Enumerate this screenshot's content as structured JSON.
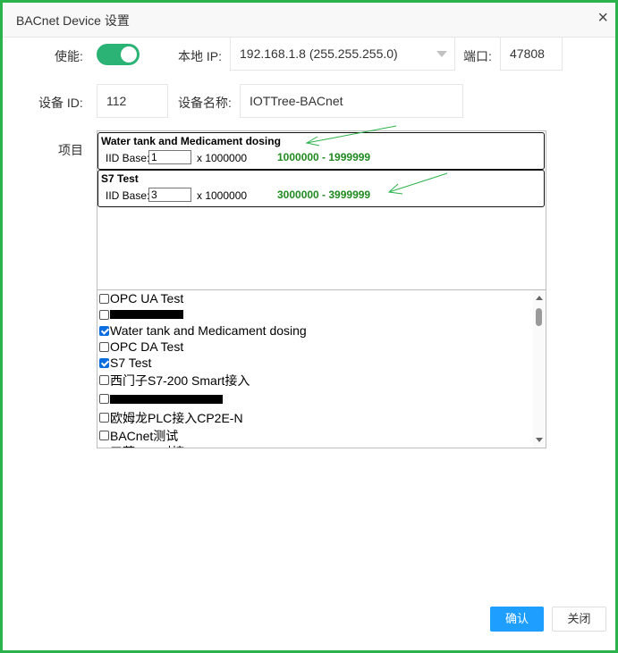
{
  "window": {
    "title": "BACnet Device 设置",
    "close_glyph": "×"
  },
  "form": {
    "enable_label": "使能:",
    "enabled": true,
    "ip_label": "本地 IP:",
    "ip_value": "192.168.1.8 (255.255.255.0)",
    "port_label": "端口:",
    "port_value": "47808",
    "device_id_label": "设备 ID:",
    "device_id_value": "112",
    "device_name_label": "设备名称:",
    "device_name_value": "IOTTree-BACnet",
    "items_label": "项目"
  },
  "selected_items": [
    {
      "title": "Water tank and Medicament dosing",
      "iid_label": "IID Base:",
      "iid_value": "1",
      "multiplier": "x 1000000",
      "range": "1000000 - 1999999"
    },
    {
      "title": "S7 Test",
      "iid_label": "IID Base:",
      "iid_value": "3",
      "multiplier": "x 1000000",
      "range": "3000000 - 3999999"
    }
  ],
  "project_list": [
    {
      "label": "OPC UA Test",
      "checked": false,
      "redacted": false
    },
    {
      "label": "",
      "checked": false,
      "redacted": true
    },
    {
      "label": "Water tank and Medicament dosing",
      "checked": true,
      "redacted": false
    },
    {
      "label": "OPC DA Test",
      "checked": false,
      "redacted": false
    },
    {
      "label": "S7 Test",
      "checked": true,
      "redacted": false
    },
    {
      "label": "西门子S7-200 Smart接入",
      "checked": false,
      "redacted": false
    },
    {
      "label": "",
      "checked": false,
      "redacted": true
    },
    {
      "label": "欧姆龙PLC接入CP2E-N",
      "checked": false,
      "redacted": false
    },
    {
      "label": "BACnet测试",
      "checked": false,
      "redacted": false
    },
    {
      "label": "三菱PLC对接",
      "checked": false,
      "redacted": false
    }
  ],
  "buttons": {
    "ok_label": "确认",
    "close_label": "关闭"
  },
  "colors": {
    "frame_border": "#2bb24c",
    "toggle_on": "#2bb275",
    "primary_button": "#1e9fff",
    "range_text": "#1f8a1f",
    "annotation_arrow": "#2bb24c"
  }
}
